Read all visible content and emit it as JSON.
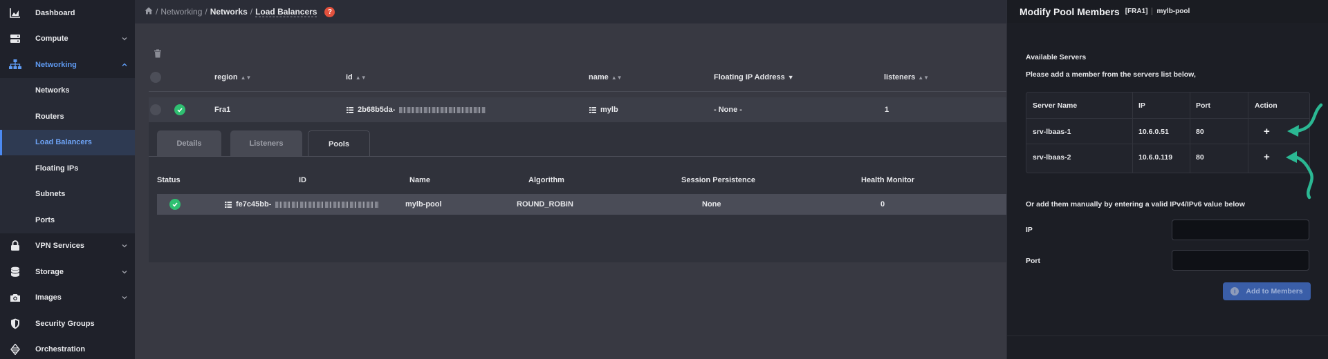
{
  "sidebar": {
    "items": [
      {
        "label": "Dashboard",
        "icon": "chart-icon"
      },
      {
        "label": "Compute",
        "icon": "server-icon"
      },
      {
        "label": "Networking",
        "icon": "network-icon"
      },
      {
        "label": "VPN Services",
        "icon": "lock-icon"
      },
      {
        "label": "Storage",
        "icon": "database-icon"
      },
      {
        "label": "Images",
        "icon": "camera-icon"
      },
      {
        "label": "Security Groups",
        "icon": "shield-icon"
      },
      {
        "label": "Orchestration",
        "icon": "orchestration-icon"
      }
    ],
    "networking_children": [
      "Networks",
      "Routers",
      "Load Balancers",
      "Floating IPs",
      "Subnets",
      "Ports"
    ],
    "accent_color": "#5f9bf3"
  },
  "breadcrumb": {
    "home_icon": "home-icon",
    "items": [
      "Networking",
      "Networks",
      "Load Balancers"
    ],
    "help_glyph": "?"
  },
  "lb_table": {
    "headers": [
      "region",
      "id",
      "name",
      "Floating IP Address",
      "listeners"
    ],
    "row": {
      "region": "Fra1",
      "id": "2b68b5da-",
      "name": "mylb",
      "floating_ip": "- None -",
      "listeners": "1"
    }
  },
  "tabs": [
    "Details",
    "Listeners",
    "Pools"
  ],
  "active_tab": "Pools",
  "pool_table": {
    "headers": [
      "Status",
      "ID",
      "Name",
      "Algorithm",
      "Session Persistence",
      "Health Monitor"
    ],
    "row": {
      "id": "fe7c45bb-",
      "name": "mylb-pool",
      "algorithm": "ROUND_ROBIN",
      "session_persistence": "None",
      "health_monitor": "0"
    }
  },
  "panel": {
    "title": "Modify Pool Members",
    "region_tag": "[FRA1]",
    "pool_name": "mylb-pool",
    "available_servers": "Available Servers",
    "instruction": "Please add a member from the servers list below,",
    "server_headers": [
      "Server Name",
      "IP",
      "Port",
      "Action"
    ],
    "servers": [
      {
        "name": "srv-lbaas-1",
        "ip": "10.6.0.51",
        "port": "80",
        "action": "+"
      },
      {
        "name": "srv-lbaas-2",
        "ip": "10.6.0.119",
        "port": "80",
        "action": "+"
      }
    ],
    "manual_text": "Or add them manually by entering a valid IPv4/IPv6 value below",
    "ip_label": "IP",
    "port_label": "Port",
    "add_button": "Add to Members",
    "info_glyph": "i",
    "arrow_color": "#2bb893"
  }
}
